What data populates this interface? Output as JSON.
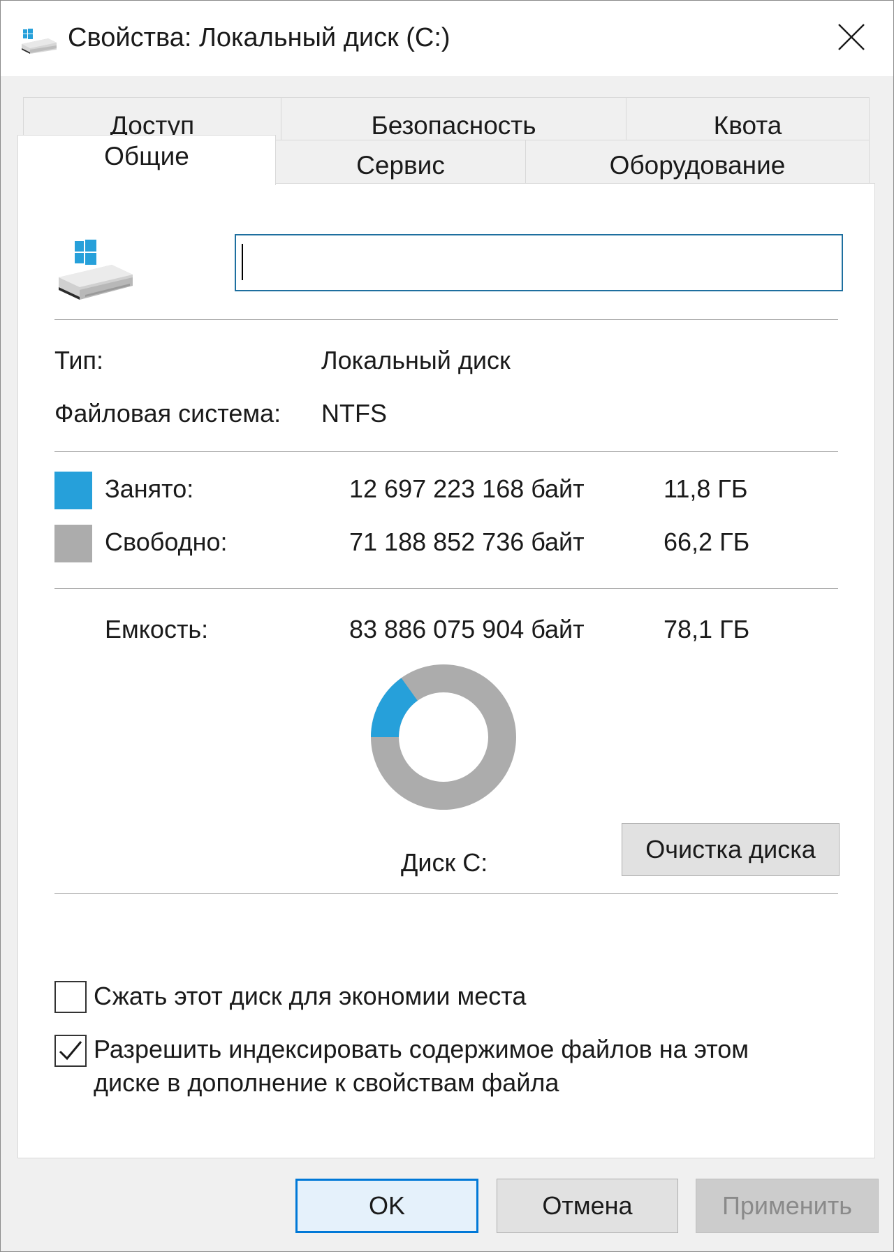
{
  "window": {
    "title": "Свойства: Локальный диск (C:)",
    "icon": "drive-icon",
    "close_icon": "close-icon"
  },
  "tabs": {
    "row1": [
      {
        "label": "Доступ"
      },
      {
        "label": "Безопасность"
      },
      {
        "label": "Квота"
      }
    ],
    "row2": [
      {
        "label": "Общие",
        "active": true
      },
      {
        "label": "Сервис"
      },
      {
        "label": "Оборудование"
      }
    ]
  },
  "general": {
    "name_value": "",
    "type_label": "Тип:",
    "type_value": "Локальный диск",
    "fs_label": "Файловая система:",
    "fs_value": "NTFS",
    "used": {
      "label": "Занято:",
      "bytes": "12 697 223 168 байт",
      "size": "11,8 ГБ",
      "color": "#26a0da"
    },
    "free": {
      "label": "Свободно:",
      "bytes": "71 188 852 736 байт",
      "size": "66,2 ГБ",
      "color": "#acacac"
    },
    "capacity": {
      "label": "Емкость:",
      "bytes": "83 886 075 904 байт",
      "size": "78,1 ГБ"
    },
    "used_fraction": 0.1514,
    "drive_caption": "Диск C:",
    "cleanup_button": "Очистка диска",
    "compress": {
      "label": "Сжать этот диск для экономии места",
      "checked": false
    },
    "index": {
      "line1": "Разрешить индексировать содержимое файлов на этом",
      "line2": "диске в дополнение к свойствам файла",
      "checked": true
    }
  },
  "footer": {
    "ok": "OK",
    "cancel": "Отмена",
    "apply": "Применить"
  },
  "colors": {
    "accent": "#26a0da",
    "focus_border": "#1e6f9f",
    "free": "#acacac"
  }
}
